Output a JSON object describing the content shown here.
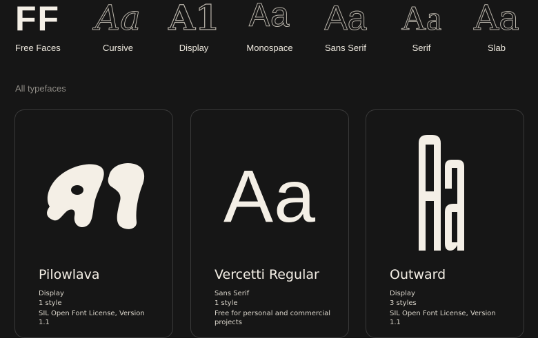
{
  "categories": [
    {
      "glyph": "FF",
      "label": "Free Faces",
      "icon": "free-faces-logo"
    },
    {
      "glyph": "Aa",
      "label": "Cursive",
      "icon": "cursive-sample-icon"
    },
    {
      "glyph": "A1",
      "label": "Display",
      "icon": "display-sample-icon"
    },
    {
      "glyph": "Aa",
      "label": "Monospace",
      "icon": "monospace-sample-icon"
    },
    {
      "glyph": "Aa",
      "label": "Sans Serif",
      "icon": "sans-serif-sample-icon"
    },
    {
      "glyph": "Aa",
      "label": "Serif",
      "icon": "serif-sample-icon"
    },
    {
      "glyph": "Aa",
      "label": "Slab",
      "icon": "slab-sample-icon"
    }
  ],
  "section_label": "All typefaces",
  "cards": [
    {
      "sample": "A1",
      "name": "Pilowlava",
      "category": "Display",
      "styles": "1 style",
      "license": "SIL Open Font License, Version 1.1"
    },
    {
      "sample": "Aa",
      "name": "Vercetti Regular",
      "category": "Sans Serif",
      "styles": "1 style",
      "license": "Free for personal and commercial projects"
    },
    {
      "sample": "Aa",
      "name": "Outward",
      "category": "Display",
      "styles": "3 styles",
      "license": "SIL Open Font License, Version 1.1"
    }
  ],
  "colors": {
    "background": "#161616",
    "text": "#f1ece2",
    "muted": "#8d8a84",
    "card_border": "#3a3a3a"
  }
}
